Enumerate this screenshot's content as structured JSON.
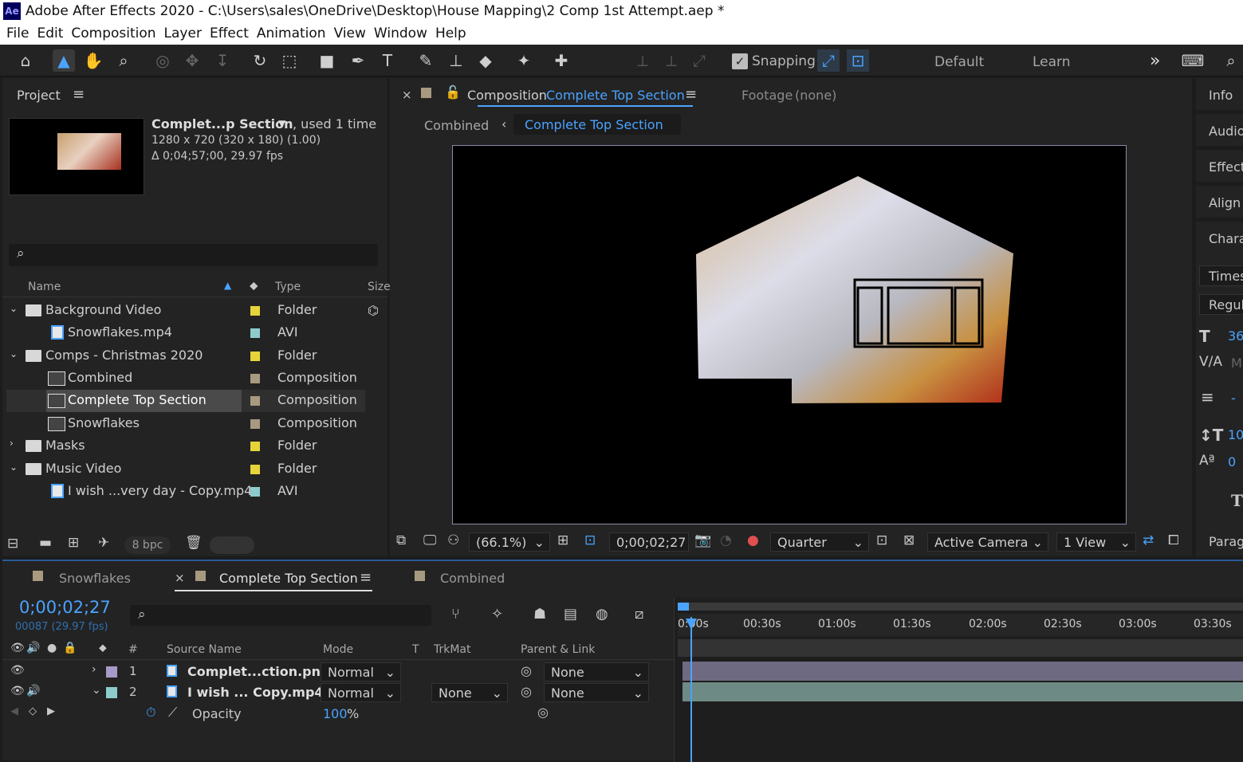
{
  "window": {
    "app_badge": "Ae",
    "title": "Adobe After Effects 2020 - C:\\Users\\sales\\OneDrive\\Desktop\\House Mapping\\2 Comp 1st Attempt.aep *"
  },
  "menu": [
    "File",
    "Edit",
    "Composition",
    "Layer",
    "Effect",
    "Animation",
    "View",
    "Window",
    "Help"
  ],
  "toolbar": {
    "snapping": "Snapping",
    "workspace_default": "Default",
    "workspace_learn": "Learn",
    "more": "»"
  },
  "project": {
    "tab": "Project",
    "preview_name": "Complet...p Section",
    "used": ", used 1 time",
    "dims": "1280 x 720  (320 x 180) (1.00)",
    "duration": "Δ 0;04;57;00, 29.97 fps",
    "col_name": "Name",
    "col_type": "Type",
    "col_size": "Size",
    "items": [
      {
        "name": "Background Video",
        "type": "Folder",
        "kind": "folder",
        "expanded": true,
        "color": "#e6d43a"
      },
      {
        "name": "Snowflakes.mp4",
        "type": "AVI",
        "kind": "file",
        "color": "#8ecccc"
      },
      {
        "name": "Comps - Christmas 2020",
        "type": "Folder",
        "kind": "folder",
        "expanded": true,
        "color": "#e6d43a"
      },
      {
        "name": "Combined",
        "type": "Composition",
        "kind": "comp",
        "color": "#a89a80"
      },
      {
        "name": "Complete Top Section",
        "type": "Composition",
        "kind": "comp",
        "selected": true,
        "color": "#a89a80"
      },
      {
        "name": "Snowflakes",
        "type": "Composition",
        "kind": "comp",
        "color": "#a89a80"
      },
      {
        "name": "Masks",
        "type": "Folder",
        "kind": "folder",
        "expanded": false,
        "color": "#e6d43a"
      },
      {
        "name": "Music Video",
        "type": "Folder",
        "kind": "folder",
        "expanded": true,
        "color": "#e6d43a"
      },
      {
        "name": "I wish ...very day - Copy.mp4",
        "type": "AVI",
        "kind": "file",
        "color": "#8ecccc"
      }
    ],
    "bpc": "8 bpc"
  },
  "comp": {
    "tab_prefix": "Composition",
    "tab_name": "Complete Top Section",
    "footage_label": "Footage",
    "footage_value": "(none)",
    "crumb_combined": "Combined",
    "crumb_current": "Complete Top Section",
    "zoom": "(66.1%)",
    "timecode": "0;00;02;27",
    "resolution": "Quarter",
    "camera": "Active Camera",
    "views": "1 View"
  },
  "right_panels": [
    "Info",
    "Audio",
    "Effect",
    "Align",
    "Chara",
    "Times",
    "Regul",
    "36",
    "M",
    "-",
    "10",
    "0",
    "Parag"
  ],
  "timeline": {
    "tabs": [
      "Snowflakes",
      "Complete Top Section",
      "Combined"
    ],
    "timecode": "0;00;02;27",
    "frames": "00087 (29.97 fps)",
    "col_hash": "#",
    "col_source": "Source Name",
    "col_mode": "Mode",
    "col_t": "T",
    "col_trkmat": "TrkMat",
    "col_parent": "Parent & Link",
    "layers": [
      {
        "num": "1",
        "name": "Complet...ction.png",
        "mode": "Normal",
        "trkmat": "",
        "parent": "None",
        "color": "#a89ac8"
      },
      {
        "num": "2",
        "name": "I wish ... Copy.mp4",
        "mode": "Normal",
        "trkmat": "None",
        "parent": "None",
        "color": "#8ecccc"
      }
    ],
    "prop_name": "Opacity",
    "prop_value": "100",
    "prop_unit": "%",
    "ruler": [
      "0:00s",
      "00:30s",
      "01:00s",
      "01:30s",
      "02:00s",
      "02:30s",
      "03:00s",
      "03:30s"
    ],
    "colors": {
      "layer1_bar": "#6e6a82",
      "layer2_bar": "#6e8a84",
      "accent": "#4aa3ff"
    }
  }
}
